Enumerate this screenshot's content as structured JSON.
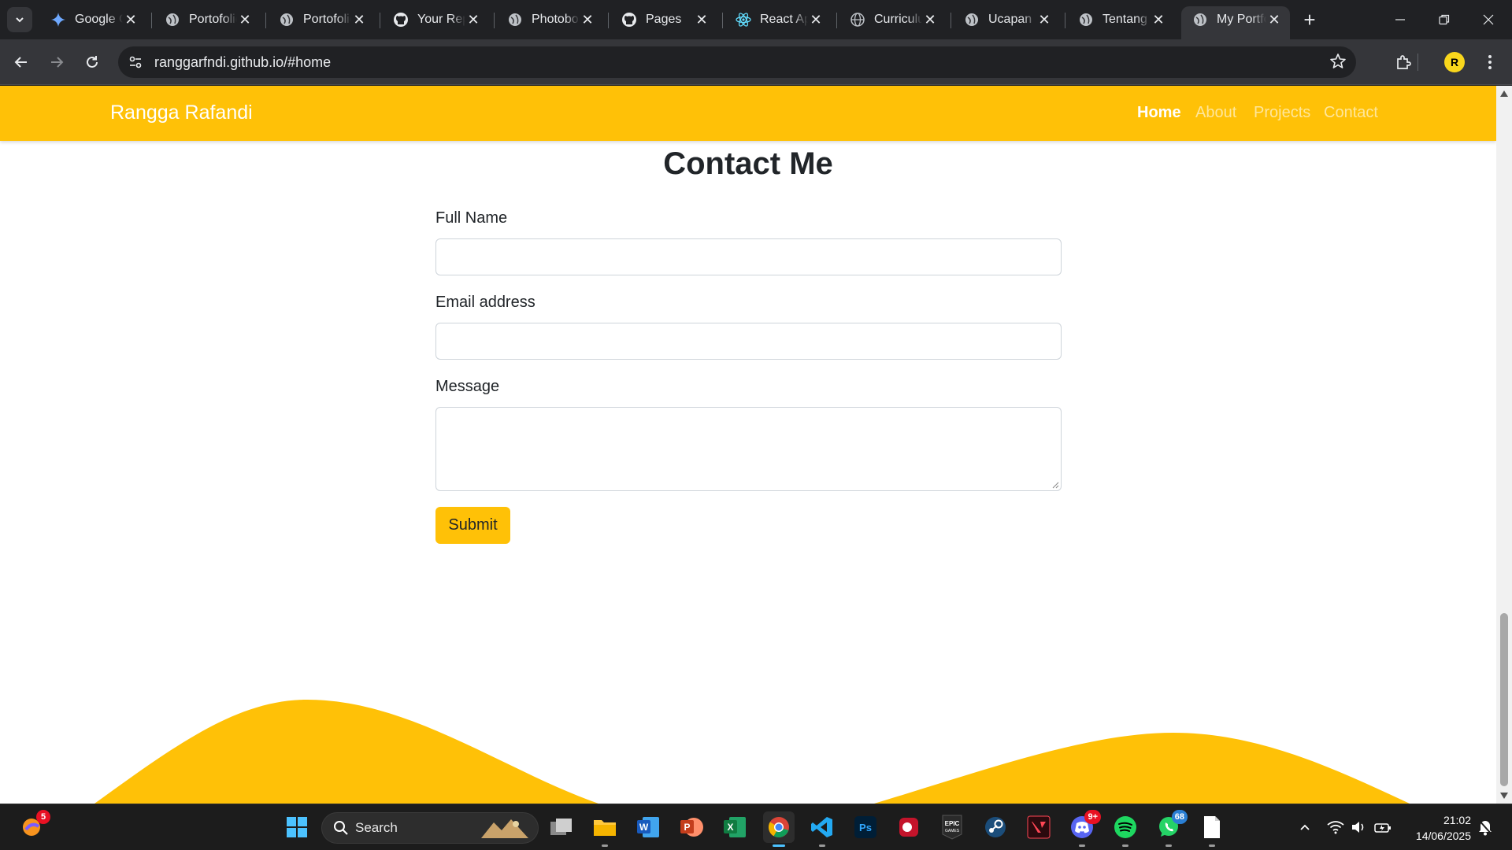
{
  "browser": {
    "tabs": [
      {
        "title": "Google Gemini",
        "icon": "gemini-icon"
      },
      {
        "title": "Portofolio",
        "icon": "globe-icon"
      },
      {
        "title": "Portofolio",
        "icon": "globe-icon"
      },
      {
        "title": "Your Repositories",
        "icon": "github-icon"
      },
      {
        "title": "Photobooth",
        "icon": "globe-icon"
      },
      {
        "title": "Pages",
        "icon": "github-icon"
      },
      {
        "title": "React App",
        "icon": "react-icon"
      },
      {
        "title": "Curriculum",
        "icon": "globe-icon"
      },
      {
        "title": "Ucapan",
        "icon": "globe-icon"
      },
      {
        "title": "Tentang",
        "icon": "globe-icon"
      },
      {
        "title": "My Portfolio",
        "icon": "globe-icon",
        "active": true
      }
    ],
    "url": "ranggarfndi.github.io/#home",
    "profile_initial": "R"
  },
  "site": {
    "brand": "Rangga Rafandi",
    "nav": [
      {
        "label": "Home",
        "active": true
      },
      {
        "label": "About"
      },
      {
        "label": "Projects"
      },
      {
        "label": "Contact"
      }
    ],
    "accent_color": "#ffc107"
  },
  "contact": {
    "title": "Contact Me",
    "fields": {
      "full_name": {
        "label": "Full Name",
        "value": ""
      },
      "email": {
        "label": "Email address",
        "value": ""
      },
      "message": {
        "label": "Message",
        "value": ""
      }
    },
    "submit_label": "Submit"
  },
  "taskbar": {
    "search_label": "Search",
    "widget_badge": "5",
    "discord_badge": "9+",
    "whatsapp_badge": "68",
    "time": "21:02",
    "date": "14/06/2025"
  }
}
